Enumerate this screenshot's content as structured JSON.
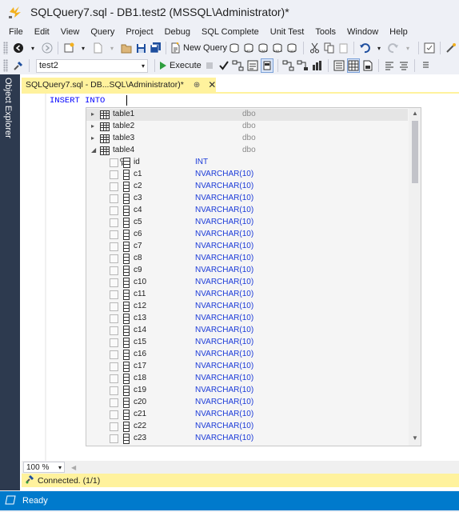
{
  "window": {
    "title": "SQLQuery7.sql - DB1.test2 (MSSQL\\Administrator)*"
  },
  "menu": {
    "items": [
      "File",
      "Edit",
      "View",
      "Query",
      "Project",
      "Debug",
      "SQL Complete",
      "Unit Test",
      "Tools",
      "Window",
      "Help"
    ]
  },
  "toolbar1": {
    "new_query_label": "New Query"
  },
  "toolbar2": {
    "database_value": "test2",
    "execute_label": "Execute"
  },
  "left_rail": {
    "object_explorer_label": "Object Explorer"
  },
  "document_tab": {
    "label": "SQLQuery7.sql - DB...SQL\\Administrator)*",
    "pin_glyph": "⊕",
    "close_glyph": "✕"
  },
  "editor": {
    "code_text": "INSERT INTO "
  },
  "completion": {
    "tables": [
      {
        "name": "table1",
        "schema": "dbo",
        "expanded": false
      },
      {
        "name": "table2",
        "schema": "dbo",
        "expanded": false
      },
      {
        "name": "table3",
        "schema": "dbo",
        "expanded": false
      },
      {
        "name": "table4",
        "schema": "dbo",
        "expanded": true
      }
    ],
    "columns": [
      {
        "name": "id",
        "type": "INT",
        "key": true
      },
      {
        "name": "c1",
        "type": "NVARCHAR(10)"
      },
      {
        "name": "c2",
        "type": "NVARCHAR(10)"
      },
      {
        "name": "c3",
        "type": "NVARCHAR(10)"
      },
      {
        "name": "c4",
        "type": "NVARCHAR(10)"
      },
      {
        "name": "c5",
        "type": "NVARCHAR(10)"
      },
      {
        "name": "c6",
        "type": "NVARCHAR(10)"
      },
      {
        "name": "c7",
        "type": "NVARCHAR(10)"
      },
      {
        "name": "c8",
        "type": "NVARCHAR(10)"
      },
      {
        "name": "c9",
        "type": "NVARCHAR(10)"
      },
      {
        "name": "c10",
        "type": "NVARCHAR(10)"
      },
      {
        "name": "c11",
        "type": "NVARCHAR(10)"
      },
      {
        "name": "c12",
        "type": "NVARCHAR(10)"
      },
      {
        "name": "c13",
        "type": "NVARCHAR(10)"
      },
      {
        "name": "c14",
        "type": "NVARCHAR(10)"
      },
      {
        "name": "c15",
        "type": "NVARCHAR(10)"
      },
      {
        "name": "c16",
        "type": "NVARCHAR(10)"
      },
      {
        "name": "c17",
        "type": "NVARCHAR(10)"
      },
      {
        "name": "c18",
        "type": "NVARCHAR(10)"
      },
      {
        "name": "c19",
        "type": "NVARCHAR(10)"
      },
      {
        "name": "c20",
        "type": "NVARCHAR(10)"
      },
      {
        "name": "c21",
        "type": "NVARCHAR(10)"
      },
      {
        "name": "c22",
        "type": "NVARCHAR(10)"
      },
      {
        "name": "c23",
        "type": "NVARCHAR(10)"
      }
    ]
  },
  "zoom": {
    "value": "100 %"
  },
  "connection": {
    "status_text": "Connected. (1/1)"
  },
  "statusbar": {
    "text": "Ready"
  },
  "colors": {
    "statusbar_bg": "#007acc",
    "tab_active_bg": "#fff29d",
    "keyword_blue": "#0000ff",
    "type_blue": "#1a3ad8",
    "left_rail_bg": "#2d3a4f",
    "execute_green": "#2e9e3e"
  },
  "icons": {
    "app": "ssms-app-icon",
    "new_query": "new-query-icon",
    "execute": "play-icon",
    "table": "table-icon",
    "column": "column-icon",
    "key_column": "primary-key-icon"
  }
}
